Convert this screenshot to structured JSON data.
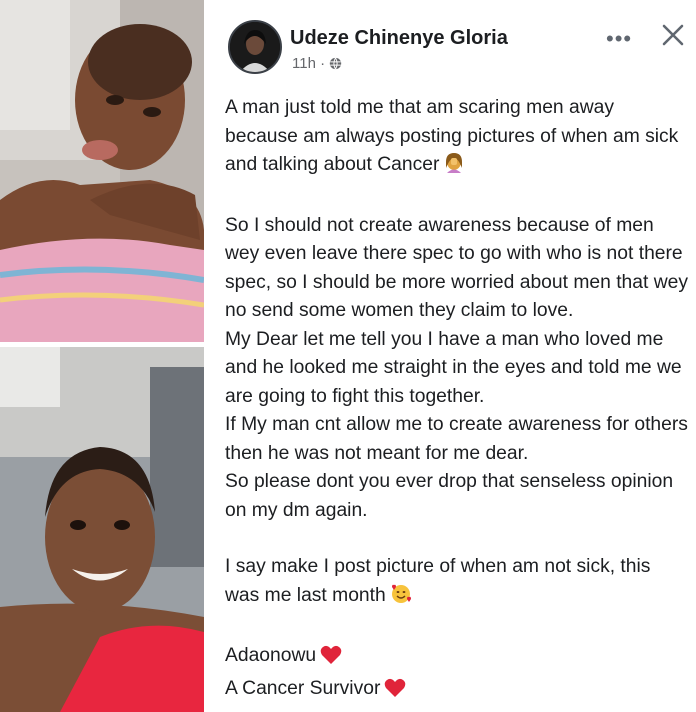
{
  "post": {
    "author": "Udeze Chinenye Gloria",
    "time": "11h ·",
    "more_label": "•••",
    "paragraphs": [
      "A man just told me that am scaring men away because am always posting pictures of when am sick and talking about Cancer",
      "So I should not create awareness because of men wey even leave there spec to go with who is not there spec, so I should be more worried about men that wey no send some women they claim to love.",
      "My Dear let me tell you I have a man who loved me and he looked me straight in the eyes and told me we are going to fight this together.",
      "If My man cnt allow me to create awareness for others then he was not meant for me dear.",
      "So please dont you ever drop that senseless opinion on my dm again.",
      "I say make I post picture of when am not sick, this was me last month",
      "Adaonowu",
      "A Cancer Survivor"
    ]
  },
  "icons": {
    "p1_emoji": "facepalm-woman-emoji",
    "p6_emoji": "smiling-face-with-hearts-emoji",
    "heart": "red-heart-emoji",
    "globe": "globe-icon",
    "close": "close-icon"
  },
  "colors": {
    "text": "#1c1e21",
    "meta": "#65676b",
    "heart": "#e0243a"
  }
}
